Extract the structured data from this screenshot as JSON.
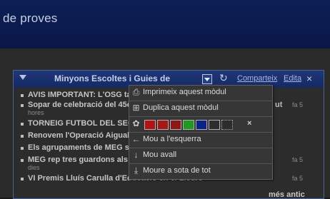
{
  "header": {
    "site_title": "de proves"
  },
  "widget": {
    "title": "Minyons Escoltes i Guies de",
    "share_label": "Comparteix",
    "edit_label": "Edita",
    "more_label": "més antic",
    "news": [
      {
        "text": "AVIS IMPORTANT: L'OSG tan",
        "tail": "",
        "time": "",
        "cont": ""
      },
      {
        "text": "Sopar de celebració del 45è",
        "tail": "ut",
        "time": "fa 5",
        "cont": "hores"
      },
      {
        "text": "TORNEIG FUTBOL DEL SECT",
        "tail": "",
        "time": "",
        "cont": ""
      },
      {
        "text": "Renovem l'Operació Aiguaba",
        "tail": "",
        "time": "",
        "cont": ""
      },
      {
        "text": "Els agrupaments de MEG s'a",
        "tail": "",
        "time": "",
        "cont": ""
      },
      {
        "text": "MEG rep tres guardons als V",
        "tail": "",
        "time": "fa 5",
        "cont": "dies"
      },
      {
        "text": "VI Premis Lluís Carulla d'Educació en el Lleure",
        "tail": "",
        "time": "fa 5",
        "cont": ""
      }
    ]
  },
  "dropdown": {
    "items": [
      {
        "icon": "printer-icon",
        "label": "Imprimeix aquest mòdul"
      },
      {
        "icon": "duplicate-icon",
        "label": "Duplica aquest mòdul"
      },
      {
        "icon": "palette-icon",
        "label": ""
      },
      {
        "icon": "arrow-left-icon",
        "label": "Mou a l'esquerra"
      },
      {
        "icon": "arrow-down-icon",
        "label": "Mou avall"
      },
      {
        "icon": "move-bottom-icon",
        "label": "Moure a sota de tot"
      }
    ],
    "colors": [
      "#b01313",
      "#a51818",
      "#8f1717",
      "#1f9a1f",
      "#0c2386",
      "#2d2d2d",
      "#2c2c2c"
    ],
    "clear_glyph": "×"
  }
}
